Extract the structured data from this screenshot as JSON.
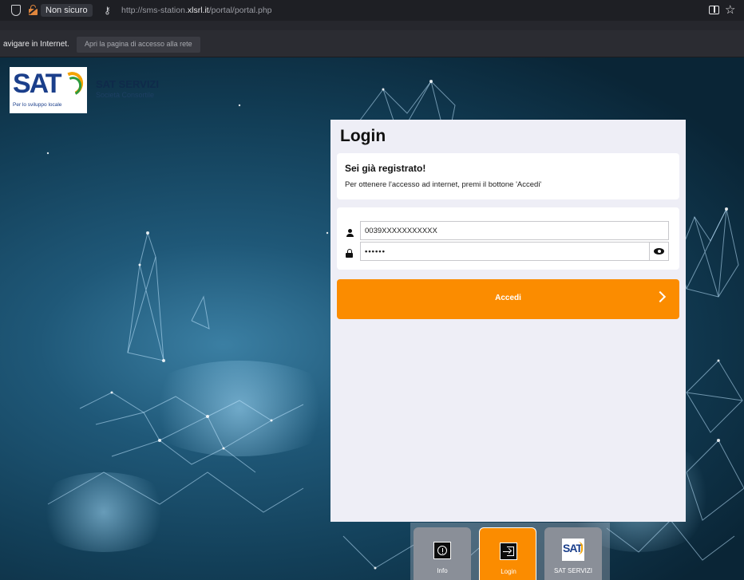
{
  "browser": {
    "not_secure": "Non sicuro",
    "url_prefix": "http://sms-station.",
    "url_domain": "xlsrl.it",
    "url_path": "/portal/portal.php",
    "notification": "avigare in Internet.",
    "open_login_page": "Apri la pagina di accesso alla rete"
  },
  "brand": {
    "logo_text": "SAT",
    "logo_tagline": "Per lo sviluppo locale",
    "name": "SAT SERVIZI",
    "subtitle": "Società Consortile"
  },
  "login": {
    "title": "Login",
    "registered_heading": "Sei già registrato!",
    "registered_text": "Per ottenere l'accesso ad internet, premi il bottone 'Accedi'",
    "username_value": "0039XXXXXXXXXXX",
    "password_value": "••••••",
    "submit_label": "Accedi"
  },
  "bottom_nav": {
    "items": [
      {
        "label": "Info",
        "icon": "info-icon"
      },
      {
        "label": "Login",
        "icon": "sign-in-icon"
      },
      {
        "label": "SAT SERVIZI",
        "icon": "sat-logo-icon"
      }
    ],
    "mini_logo": "SAT"
  },
  "colors": {
    "accent": "#fb8c00",
    "panel": "#eeeef6",
    "logo_blue": "#1b3f8b"
  }
}
